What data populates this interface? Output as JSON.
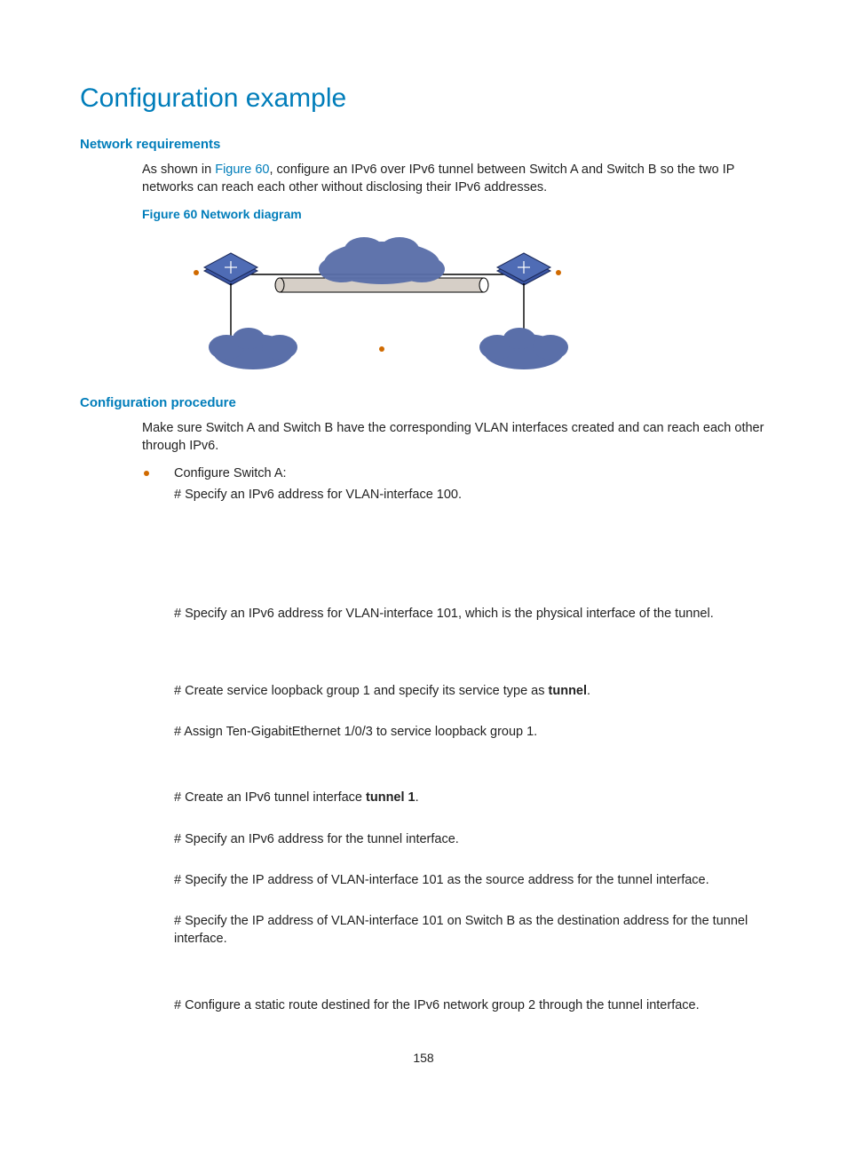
{
  "page": {
    "title": "Configuration example",
    "pagenum": "158"
  },
  "sec_netreq": {
    "heading": "Network requirements",
    "p1_a": "As shown in ",
    "p1_link": "Figure 60",
    "p1_b": ", configure an IPv6 over IPv6 tunnel between Switch A and Switch B so the two IP networks can reach each other without disclosing their IPv6 addresses.",
    "fig_caption": "Figure 60 Network diagram"
  },
  "sec_proc": {
    "heading": "Configuration procedure",
    "intro": "Make sure Switch A and Switch B have the corresponding VLAN interfaces created and can reach each other through IPv6.",
    "bullet1": "Configure Switch A:",
    "s1": "# Specify an IPv6 address for VLAN-interface 100.",
    "s2": "# Specify an IPv6 address for VLAN-interface 101, which is the physical interface of the tunnel.",
    "s3_a": "# Create service loopback group 1 and specify its service type as ",
    "s3_bold": "tunnel",
    "s3_b": ".",
    "s4": "# Assign Ten-GigabitEthernet 1/0/3 to service loopback group 1.",
    "s5_a": "# Create an IPv6 tunnel interface ",
    "s5_bold": "tunnel 1",
    "s5_b": ".",
    "s6": "# Specify an IPv6 address for the tunnel interface.",
    "s7": "# Specify the IP address of VLAN-interface 101 as the source address for the tunnel interface.",
    "s8": "# Specify the IP address of VLAN-interface 101 on Switch B as the destination address for the tunnel interface.",
    "s9": "# Configure a static route destined for the IPv6 network group 2 through the tunnel interface."
  }
}
